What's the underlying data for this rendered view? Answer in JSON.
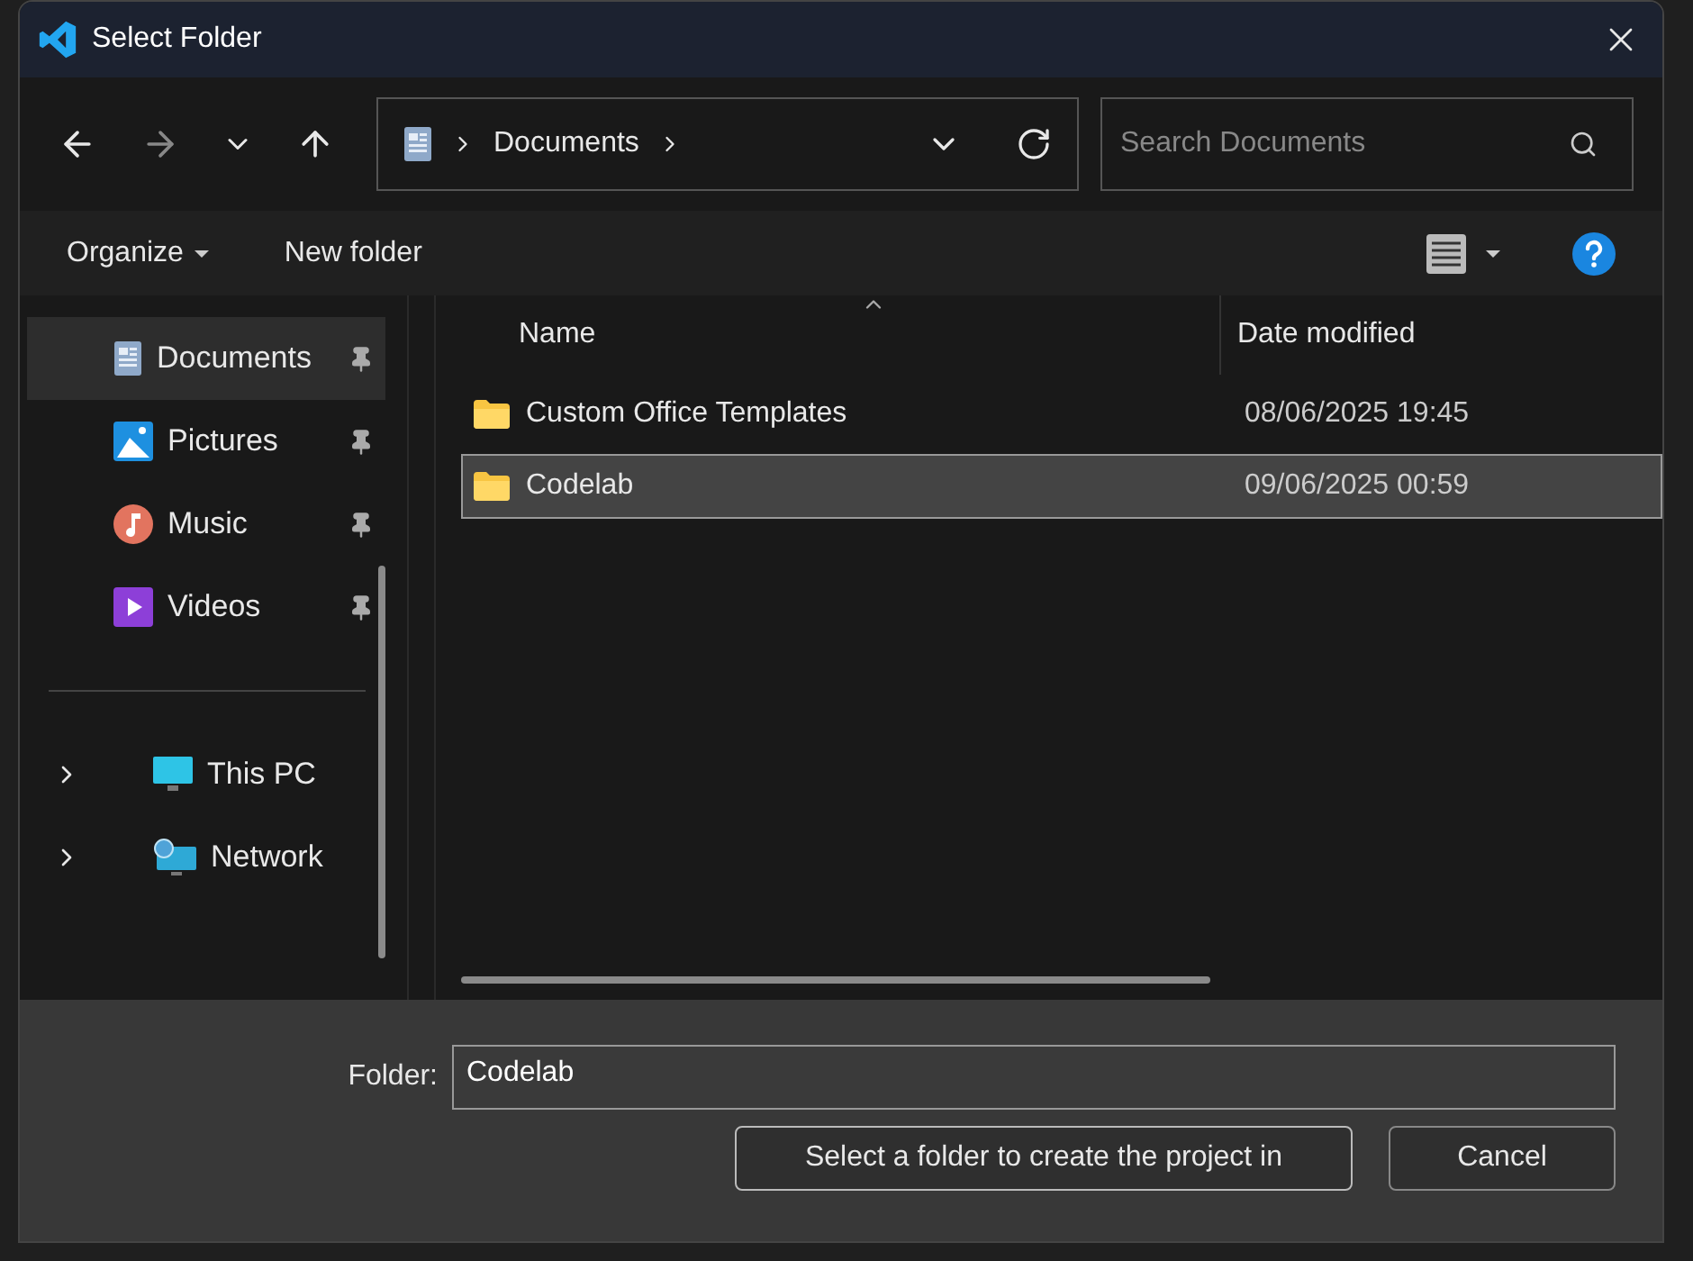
{
  "window": {
    "title": "Select Folder"
  },
  "address_bar": {
    "crumbs": [
      "Documents"
    ]
  },
  "search": {
    "placeholder": "Search Documents"
  },
  "toolbar": {
    "organize": "Organize",
    "new_folder": "New folder"
  },
  "sidebar": {
    "quick_access": [
      {
        "label": "Documents",
        "kind": "documents",
        "selected": true
      },
      {
        "label": "Pictures",
        "kind": "pictures",
        "selected": false
      },
      {
        "label": "Music",
        "kind": "music",
        "selected": false
      },
      {
        "label": "Videos",
        "kind": "videos",
        "selected": false
      }
    ],
    "locations": [
      {
        "label": "This PC",
        "kind": "pc",
        "expanded": false
      },
      {
        "label": "Network",
        "kind": "network",
        "expanded": false
      }
    ]
  },
  "table": {
    "columns": [
      "Name",
      "Date modified"
    ],
    "rows": [
      {
        "name": "Custom Office Templates",
        "date": "08/06/2025 19:45",
        "selected": false
      },
      {
        "name": "Codelab",
        "date": "09/06/2025 00:59",
        "selected": true
      }
    ]
  },
  "footer": {
    "folder_label": "Folder:",
    "folder_value": "Codelab",
    "buttons": [
      "Select a folder to create the project in",
      "Cancel"
    ]
  }
}
